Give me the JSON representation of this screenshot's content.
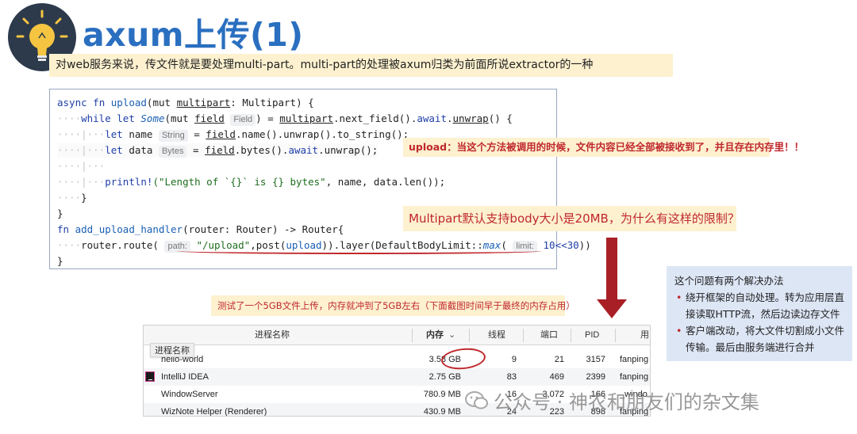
{
  "title": "axum上传(1)",
  "subtitle": "对web服务来说，传文件就是要处理multi-part。multi-part的处理被axum归类为前面所说extractor的一种",
  "code": {
    "l1_async": "async",
    "l1_fn": "fn",
    "l1_name": "upload",
    "l1_p1": "(mut ",
    "l1_var": "multipart",
    "l1_p2": ": Multipart) {",
    "l2_while": "while",
    "l2_let": "let",
    "l2_some": "Some",
    "l2_p1": "(mut ",
    "l2_field": "field",
    "l2_hint": "Field",
    "l2_p2": ") = ",
    "l2_mp": "multipart",
    "l2_p3": ".next_field().",
    "l2_await": "await",
    "l2_p4": ".",
    "l2_unwrap": "unwrap",
    "l2_p5": "() {",
    "l3_let": "let",
    "l3_name": " name",
    "l3_hint": "String",
    "l3_p1": " = ",
    "l3_field": "field",
    "l3_p2": ".name().unwrap().to_string();",
    "l4_let": "let",
    "l4_name": " data",
    "l4_hint": "Bytes",
    "l4_p1": " = ",
    "l4_field": "field",
    "l4_p2": ".bytes().",
    "l4_await": "await",
    "l4_p3": ".unwrap();",
    "l6_macro": "println!",
    "l6_str": "(\"Length of `{}` is {} bytes\"",
    "l6_rest": ", name, data.len());",
    "l7": "}",
    "l8": "}",
    "l9_fn": "fn",
    "l9_name": "add_upload_handler",
    "l9_rest": "(router: Router) -> Router{",
    "l10_a": "router.route(",
    "l10_hint1": "path:",
    "l10_str": "\"/upload\"",
    "l10_b": ",post(",
    "l10_up": "upload",
    "l10_c": ")).layer(",
    "l10_d": "DefaultBodyLimit::",
    "l10_max": "max",
    "l10_e": "(",
    "l10_hint2": "limit:",
    "l10_num": "10<<30",
    "l10_f": "))",
    "l11": "}"
  },
  "note1": "upload：当这个方法被调用的时候，文件内容已经全部被接收到了，并且存在内存里！！",
  "note2": "Multipart默认支持body大小是20MB，为什么有这样的限制？",
  "solution": {
    "heading": "这个问题有两个解决办法",
    "items": [
      "绕开框架的自动处理。转为应用层直",
      "接读取HTTP流，然后边读边存文件",
      "客户端改动，将大文件切割成小文件",
      "传输。最后由服务端进行合并"
    ]
  },
  "caption": "测试了一个5GB文件上传，内存就冲到了5GB左右（下面截图时间早于最终的内存占用）",
  "table": {
    "tooltip": "进程名称",
    "headers": [
      "进程名称",
      "内存",
      "线程",
      "端口",
      "PID",
      "用"
    ],
    "rows": [
      {
        "name": "hello-world",
        "mem": "3.58 GB",
        "threads": "9",
        "ports": "21",
        "pid": "3157",
        "user": "fanping"
      },
      {
        "name": "IntelliJ IDEA",
        "mem": "2.75 GB",
        "threads": "83",
        "ports": "469",
        "pid": "2399",
        "user": "fanping"
      },
      {
        "name": "WindowServer",
        "mem": "780.9 MB",
        "threads": "16",
        "ports": "3,072",
        "pid": "166",
        "user": "_windo"
      },
      {
        "name": "WizNote Helper (Renderer)",
        "mem": "430.9 MB",
        "threads": "24",
        "ports": "223",
        "pid": "898",
        "user": "fanping"
      }
    ]
  },
  "watermark": "公众号 · 神农和朋友们的杂文集",
  "colors": {
    "title": "#2a6fc0",
    "note": "#c0282d",
    "noteBg": "#fdf1cf",
    "solutionBg": "#dde6f5"
  }
}
